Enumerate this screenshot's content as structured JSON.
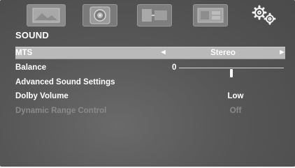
{
  "categories": [
    {
      "name": "picture-tab",
      "icon": "picture-icon",
      "selected": false
    },
    {
      "name": "sound-tab",
      "icon": "speaker-icon",
      "selected": true
    },
    {
      "name": "network-tab",
      "icon": "network-icon",
      "selected": false
    },
    {
      "name": "channels-tab",
      "icon": "channels-icon",
      "selected": false
    },
    {
      "name": "settings-tab",
      "icon": "gears-icon",
      "selected": false
    }
  ],
  "menu": {
    "title": "SOUND",
    "items": [
      {
        "label": "MTS",
        "value": "Stereo",
        "highlighted": true
      },
      {
        "label": "Balance",
        "value": "0",
        "level": 0
      },
      {
        "label": "Advanced Sound Settings",
        "value": ""
      },
      {
        "label": "Dolby Volume",
        "value": "Low"
      },
      {
        "label": "Dynamic Range Control",
        "value": "Off",
        "disabled": true
      }
    ]
  },
  "arrows": {
    "left": "◄",
    "right": "►"
  },
  "colors": {
    "background": "#575757",
    "highlight": "#b9b9b9",
    "text": "#ffffff",
    "disabled_text": "#8a8a8a"
  }
}
